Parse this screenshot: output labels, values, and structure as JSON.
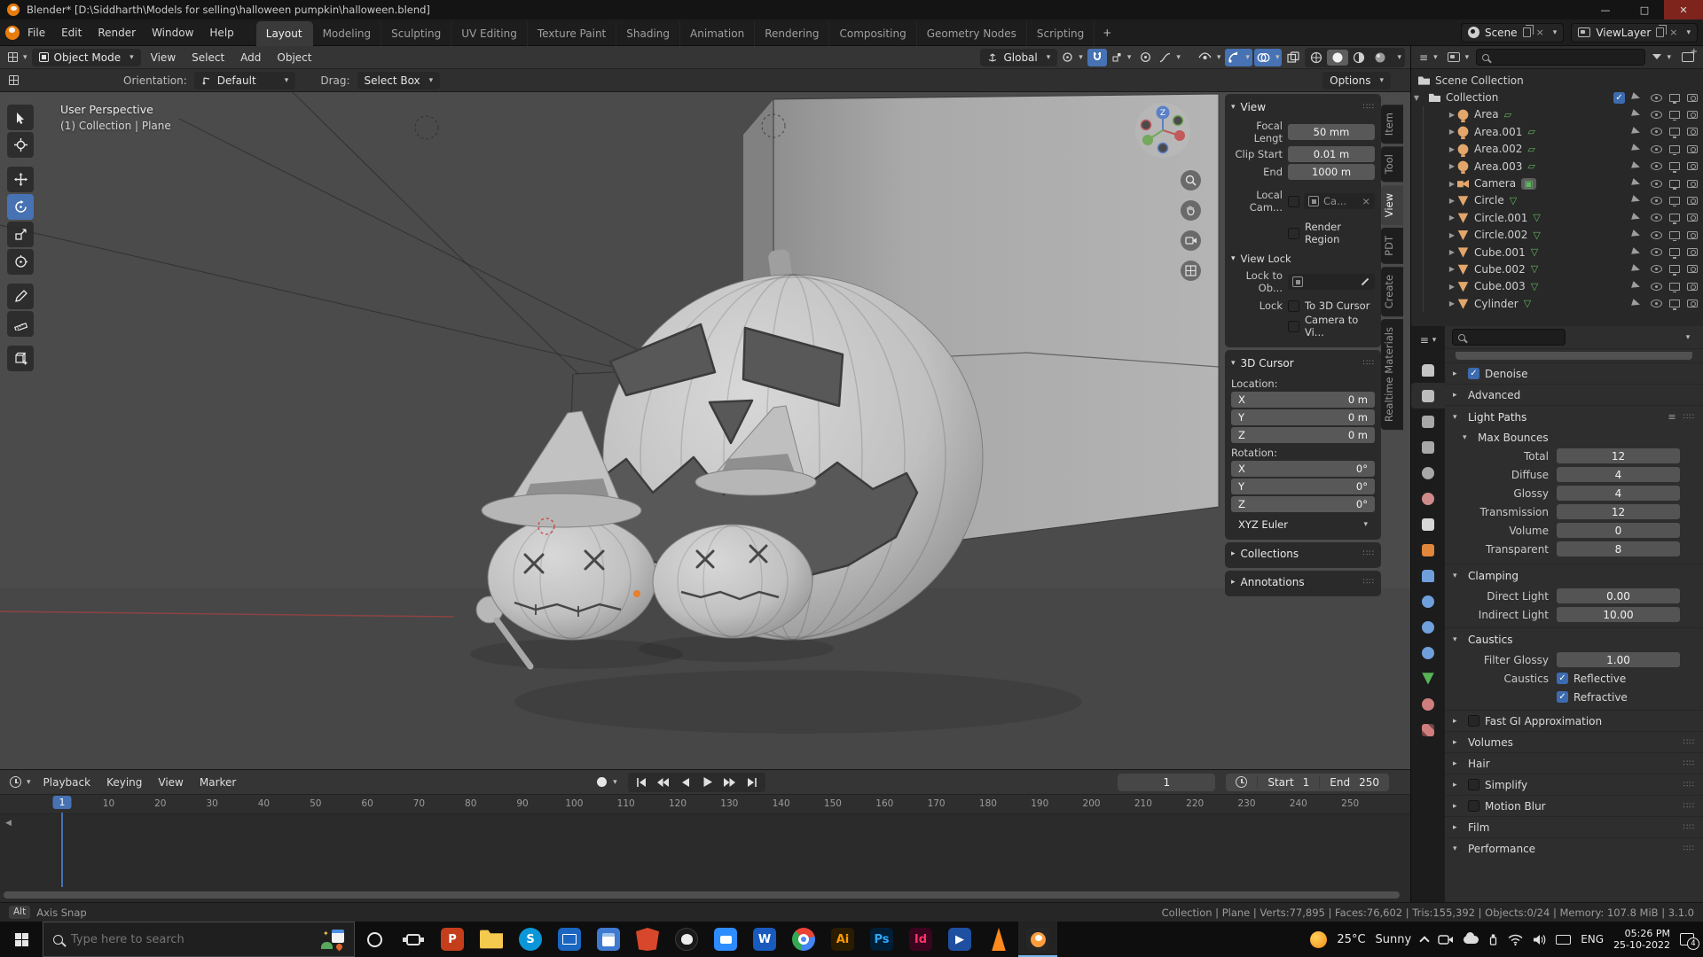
{
  "window": {
    "title": "Blender* [D:\\Siddharth\\Models for selling\\halloween pumpkin\\halloween.blend]",
    "controls": {
      "minimize": "—",
      "maximize": "□",
      "close": "✕"
    }
  },
  "topbar": {
    "menus": [
      {
        "label": "File"
      },
      {
        "label": "Edit"
      },
      {
        "label": "Render"
      },
      {
        "label": "Window"
      },
      {
        "label": "Help"
      }
    ],
    "workspaces": [
      {
        "label": "Layout",
        "active": true
      },
      {
        "label": "Modeling"
      },
      {
        "label": "Sculpting"
      },
      {
        "label": "UV Editing"
      },
      {
        "label": "Texture Paint"
      },
      {
        "label": "Shading"
      },
      {
        "label": "Animation"
      },
      {
        "label": "Rendering"
      },
      {
        "label": "Compositing"
      },
      {
        "label": "Geometry Nodes"
      },
      {
        "label": "Scripting"
      }
    ],
    "add_workspace": "+",
    "scene_label": "Scene",
    "viewlayer_label": "ViewLayer"
  },
  "header": {
    "mode": "Object Mode",
    "menus": [
      {
        "label": "View"
      },
      {
        "label": "Select"
      },
      {
        "label": "Add"
      },
      {
        "label": "Object"
      }
    ],
    "orientation": "Global",
    "options_label": "Options"
  },
  "tool_settings": {
    "orientation_label": "Orientation:",
    "orientation_value": "Default",
    "drag_label": "Drag:",
    "drag_value": "Select Box"
  },
  "viewport": {
    "overlay_line1": "User Perspective",
    "overlay_line2": "(1) Collection | Plane",
    "axis_label": "Z",
    "side_tabs": [
      {
        "label": "Item"
      },
      {
        "label": "Tool"
      },
      {
        "label": "View",
        "active": true
      },
      {
        "label": "PDT"
      },
      {
        "label": "Create"
      },
      {
        "label": "Realtime Materials"
      }
    ]
  },
  "n_panel": {
    "view_title": "View",
    "fields": [
      {
        "label": "Focal Lengt",
        "value": "50 mm"
      },
      {
        "label": "Clip Start",
        "value": "0.01 m"
      },
      {
        "label": "End",
        "value": "1000 m"
      }
    ],
    "local_camera_label": "Local Cam...",
    "local_camera_value": "Ca...",
    "render_region_label": "Render Region",
    "view_lock_title": "View Lock",
    "lock_to_object_label": "Lock to Ob...",
    "lock_label": "Lock",
    "to_3d_cursor_label": "To 3D Cursor",
    "camera_to_view_label": "Camera to Vi...",
    "cursor_title": "3D Cursor",
    "location_label": "Location:",
    "location": [
      {
        "axis": "X",
        "value": "0 m"
      },
      {
        "axis": "Y",
        "value": "0 m"
      },
      {
        "axis": "Z",
        "value": "0 m"
      }
    ],
    "rotation_label": "Rotation:",
    "rotation": [
      {
        "axis": "X",
        "value": "0°"
      },
      {
        "axis": "Y",
        "value": "0°"
      },
      {
        "axis": "Z",
        "value": "0°"
      }
    ],
    "euler_mode": "XYZ Euler",
    "collections_title": "Collections",
    "annotations_title": "Annotations"
  },
  "outliner": {
    "scene_collection": "Scene Collection",
    "collection": "Collection",
    "items": [
      {
        "name": "Area",
        "type": "light"
      },
      {
        "name": "Area.001",
        "type": "light"
      },
      {
        "name": "Area.002",
        "type": "light"
      },
      {
        "name": "Area.003",
        "type": "light"
      },
      {
        "name": "Camera",
        "type": "camera",
        "active": true
      },
      {
        "name": "Circle",
        "type": "mesh"
      },
      {
        "name": "Circle.001",
        "type": "mesh"
      },
      {
        "name": "Circle.002",
        "type": "mesh"
      },
      {
        "name": "Cube.001",
        "type": "mesh"
      },
      {
        "name": "Cube.002",
        "type": "mesh"
      },
      {
        "name": "Cube.003",
        "type": "mesh"
      },
      {
        "name": "Cylinder",
        "type": "mesh"
      }
    ]
  },
  "properties": {
    "tabs": [
      {
        "name": "tool",
        "shape": "wrench",
        "color": "#c4c4c4"
      },
      {
        "name": "render",
        "shape": "camera",
        "color": "#bdbdbd",
        "active": true
      },
      {
        "name": "output",
        "shape": "printer",
        "color": "#a8a8a8"
      },
      {
        "name": "view-layer",
        "shape": "images",
        "color": "#a8a8a8"
      },
      {
        "name": "scene",
        "shape": "circle",
        "color": "#a8a8a8"
      },
      {
        "name": "world",
        "shape": "circle",
        "color": "#cf8b8b"
      },
      {
        "name": "collection",
        "shape": "box",
        "color": "#d6d6d6"
      },
      {
        "name": "object",
        "shape": "square",
        "color": "#e0873c"
      },
      {
        "name": "modifiers",
        "shape": "wrench",
        "color": "#70a0dc"
      },
      {
        "name": "particles",
        "shape": "circle",
        "color": "#70a0dc"
      },
      {
        "name": "physics",
        "shape": "circle",
        "color": "#70a0dc"
      },
      {
        "name": "constraints",
        "shape": "circle",
        "color": "#70a0dc"
      },
      {
        "name": "data",
        "shape": "tri",
        "color": "#58b558"
      },
      {
        "name": "material",
        "shape": "circle",
        "color": "#cf7d7d"
      },
      {
        "name": "texture",
        "shape": "checker",
        "color": "#cf7d7d"
      }
    ],
    "denoise": "Denoise",
    "advanced": "Advanced",
    "light_paths": "Light Paths",
    "max_bounces": "Max Bounces",
    "bounces": [
      {
        "label": "Total",
        "value": "12"
      },
      {
        "label": "Diffuse",
        "value": "4"
      },
      {
        "label": "Glossy",
        "value": "4"
      },
      {
        "label": "Transmission",
        "value": "12"
      },
      {
        "label": "Volume",
        "value": "0"
      },
      {
        "label": "Transparent",
        "value": "8"
      }
    ],
    "clamping": "Clamping",
    "clamps": [
      {
        "label": "Direct Light",
        "value": "0.00"
      },
      {
        "label": "Indirect Light",
        "value": "10.00"
      }
    ],
    "caustics_title": "Caustics",
    "filter_glossy_label": "Filter Glossy",
    "filter_glossy_value": "1.00",
    "caustics_label": "Caustics",
    "reflective": "Reflective",
    "refractive": "Refractive",
    "fast_gi": "Fast GI Approximation",
    "more_panels": [
      {
        "label": "Volumes"
      },
      {
        "label": "Hair"
      },
      {
        "label": "Simplify",
        "checkbox": true
      },
      {
        "label": "Motion Blur",
        "checkbox": true
      },
      {
        "label": "Film"
      }
    ],
    "performance": "Performance"
  },
  "timeline": {
    "menus": [
      {
        "label": "Playback",
        "caret": true
      },
      {
        "label": "Keying",
        "caret": true
      },
      {
        "label": "View"
      },
      {
        "label": "Marker"
      }
    ],
    "frames": [
      1,
      10,
      20,
      30,
      40,
      50,
      60,
      70,
      80,
      90,
      100,
      110,
      120,
      130,
      140,
      150,
      160,
      170,
      180,
      190,
      200,
      210,
      220,
      230,
      240,
      250
    ],
    "frame_field": "1",
    "start_label": "Start",
    "start_value": "1",
    "end_label": "End",
    "end_value": "250"
  },
  "status": {
    "key_hint": "Alt",
    "hint_text": "Axis Snap",
    "stats": "Collection | Plane | Verts:77,895 | Faces:76,602 | Tris:155,392 | Objects:0/24 | Memory: 107.8 MiB | 3.1.0"
  },
  "taskbar": {
    "search_placeholder": "Type here to search",
    "apps": [
      {
        "name": "cortana"
      },
      {
        "name": "task-view"
      },
      {
        "name": "powerpoint",
        "text": "P",
        "bg": "#c43e1c"
      },
      {
        "name": "explorer",
        "bg": "#f3c94e"
      },
      {
        "name": "skype",
        "text": "S",
        "bg": "#0a96d8"
      },
      {
        "name": "mail",
        "bg": "#1a66c0"
      },
      {
        "name": "calendar",
        "bg": "#3f7ad1"
      },
      {
        "name": "brave",
        "bg": "#d8472b"
      },
      {
        "name": "github",
        "bg": "#1a1a1a"
      },
      {
        "name": "zoom",
        "bg": "#2d8cff"
      },
      {
        "name": "word",
        "text": "W",
        "bg": "#185abd"
      },
      {
        "name": "chrome"
      },
      {
        "name": "illustrator",
        "text": "Ai",
        "bg": "#2b1c00",
        "fg": "#ff9a00"
      },
      {
        "name": "photoshop",
        "text": "Ps",
        "bg": "#001e36",
        "fg": "#31a8ff"
      },
      {
        "name": "indesign",
        "text": "Id",
        "bg": "#3a041f",
        "fg": "#ff3366"
      },
      {
        "name": "player",
        "text": "▶",
        "bg": "#1f4fa0"
      },
      {
        "name": "vlc",
        "bg": "#ff8a1e"
      },
      {
        "name": "blender",
        "active": true
      }
    ],
    "weather_temp": "25°C",
    "weather_cond": "Sunny",
    "language": "ENG",
    "time": "05:26 PM",
    "date": "25-10-2022",
    "notifications": "4"
  }
}
